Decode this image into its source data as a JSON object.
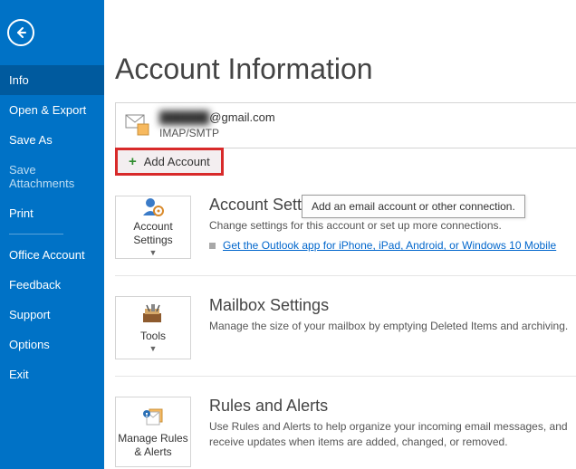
{
  "sidebar": {
    "items": [
      {
        "label": "Info",
        "selected": true
      },
      {
        "label": "Open & Export"
      },
      {
        "label": "Save As"
      },
      {
        "label": "Save Attachments",
        "dim": true
      },
      {
        "label": "Print"
      }
    ],
    "lower": [
      {
        "label": "Office Account"
      },
      {
        "label": "Feedback"
      },
      {
        "label": "Support"
      },
      {
        "label": "Options"
      },
      {
        "label": "Exit"
      }
    ]
  },
  "page_title": "Account Information",
  "account": {
    "email_hidden": "██████",
    "email_suffix": "@gmail.com",
    "protocol": "IMAP/SMTP"
  },
  "add_account": {
    "label": "Add Account",
    "tooltip": "Add an email account or other connection."
  },
  "sections": {
    "account_settings": {
      "button": "Account Settings",
      "title": "Account Settings",
      "desc": "Change settings for this account or set up more connections.",
      "link": "Get the Outlook app for iPhone, iPad, Android, or Windows 10 Mobile"
    },
    "mailbox": {
      "button": "Tools",
      "title": "Mailbox Settings",
      "desc": "Manage the size of your mailbox by emptying Deleted Items and archiving."
    },
    "rules": {
      "button": "Manage Rules & Alerts",
      "title": "Rules and Alerts",
      "desc": "Use Rules and Alerts to help organize your incoming email messages, and receive updates when items are added, changed, or removed."
    }
  }
}
